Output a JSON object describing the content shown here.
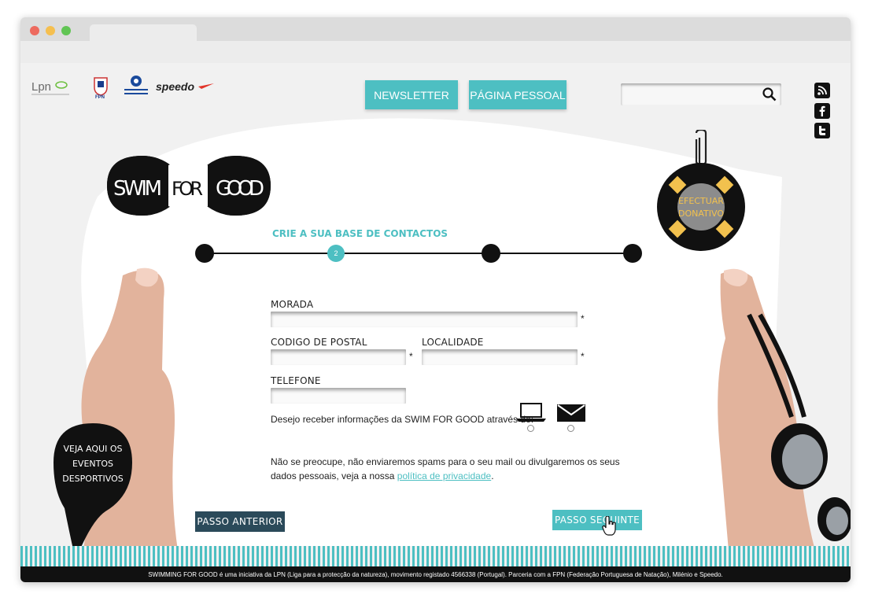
{
  "window": {
    "controls": [
      "close",
      "minimize",
      "maximize"
    ]
  },
  "header": {
    "logos": [
      "Lpn",
      "FPN",
      "Instituto do Desporto",
      "speedo"
    ],
    "nav": {
      "newsletter": "NEWSLETTER",
      "personal_page": "PÁGINA PESSOAL"
    },
    "search": {
      "placeholder": "",
      "value": ""
    },
    "social": [
      "rss-icon",
      "facebook-icon",
      "twitter-icon"
    ]
  },
  "brand": {
    "swim": "SWIM",
    "for": "FOR",
    "good": "GOOD"
  },
  "donate": {
    "line1": "EFECTUAR",
    "line2": "DONATIVO"
  },
  "steps": {
    "title": "CRIE A SUA BASE DE CONTACTOS",
    "current": "2",
    "total": 4
  },
  "form": {
    "morada_label": "MORADA",
    "codigo_label": "CODIGO DE POSTAL",
    "localidade_label": "LOCALIDADE",
    "telefone_label": "TELEFONE",
    "required_mark": "*",
    "contact_pref_label": "Desejo receber informações da SWIM FOR GOOD através de:",
    "contact_options": [
      "laptop-icon",
      "envelope-icon"
    ],
    "notice_line1": "Não se preocupe, não enviaremos spams para o seu mail ou divulgaremos os seus",
    "notice_line2_prefix": "dados pessoais, veja a nossa ",
    "privacy_link": "política de privacidade",
    "notice_line2_suffix": "."
  },
  "buttons": {
    "prev": "PASSO ANTERIOR",
    "next": "PASSO SEGUINTE"
  },
  "events_bubble": {
    "line1": "VEJA AQUI OS",
    "line2": "EVENTOS",
    "line3": "DESPORTIVOS"
  },
  "footer": {
    "text": "SWIMMING FOR GOOD é uma iniciativa da LPN (Liga para a protecção da natureza), movimento registado 4566338 (Portugal). Parceria com a FPN (Federação Portuguesa de Natação), Milénio e Speedo."
  },
  "colors": {
    "accent": "#4dbfc2",
    "dark_button": "#2b4a5a",
    "black": "#111111"
  }
}
